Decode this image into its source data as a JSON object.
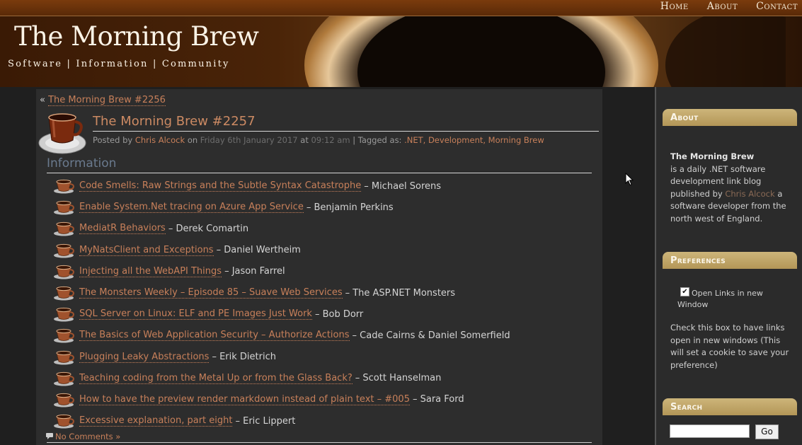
{
  "header": {
    "nav": [
      "Home",
      "About",
      "Contact"
    ],
    "title": "The Morning Brew",
    "tagline": "Software | Information | Community"
  },
  "post": {
    "prev_prefix": "«",
    "prev_link": "The Morning Brew #2256",
    "title": "The Morning Brew #2257",
    "meta": {
      "posted_by": "Posted by",
      "author": "Chris Alcock",
      "on": "on",
      "date": "Friday 6th January 2017",
      "at": "at",
      "time": "09:12 am",
      "tagged": "| Tagged as:",
      "tags": ".NET, Development, Morning Brew"
    },
    "section": "Information",
    "items": [
      {
        "title": "Code Smells: Raw Strings and the Subtle Syntax Catastrophe",
        "author": "– Michael Sorens"
      },
      {
        "title": "Enable System.Net tracing on Azure App Service",
        "author": "– Benjamin Perkins"
      },
      {
        "title": "MediatR Behaviors",
        "author": "– Derek Comartin"
      },
      {
        "title": "MyNatsClient and Exceptions",
        "author": "– Daniel Wertheim"
      },
      {
        "title": "Injecting all the WebAPI Things",
        "author": "– Jason Farrel"
      },
      {
        "title": "The Monsters Weekly – Episode 85 – Suave Web Services",
        "author": "– The ASP.NET Monsters"
      },
      {
        "title": "SQL Server on Linux: ELF and PE Images Just Work",
        "author": "– Bob Dorr"
      },
      {
        "title": "The Basics of Web Application Security – Authorize Actions",
        "author": "– Cade Cairns & Daniel Somerfield"
      },
      {
        "title": "Plugging Leaky Abstractions",
        "author": "– Erik Dietrich"
      },
      {
        "title": "Teaching coding from the Metal Up or from the Glass Back?",
        "author": "– Scott Hanselman"
      },
      {
        "title": "How to have the preview render markdown instead of plain text – #005",
        "author": "– Sara Ford"
      },
      {
        "title": "Excessive explanation, part eight",
        "author": "– Eric Lippert"
      }
    ],
    "comments": "No Comments »"
  },
  "sidebar": {
    "about": {
      "heading": "About",
      "name": "The Morning Brew",
      "text1": "is a daily .NET software development link blog published by",
      "author": "Chris Alcock",
      "text2": "a software developer from the north west of England."
    },
    "preferences": {
      "heading": "Preferences",
      "checkbox_label": "Open Links in new Window",
      "checked": true,
      "description": "Check this box to have links open in new windows (This will set a cookie to save your preference)"
    },
    "search": {
      "heading": "Search",
      "value": "",
      "button": "Go"
    }
  },
  "colors": {
    "link": "#c8805a",
    "panel": "#2d2d2d",
    "widget_head": "#c2a86a",
    "section_heading": "#6a7a8e"
  }
}
